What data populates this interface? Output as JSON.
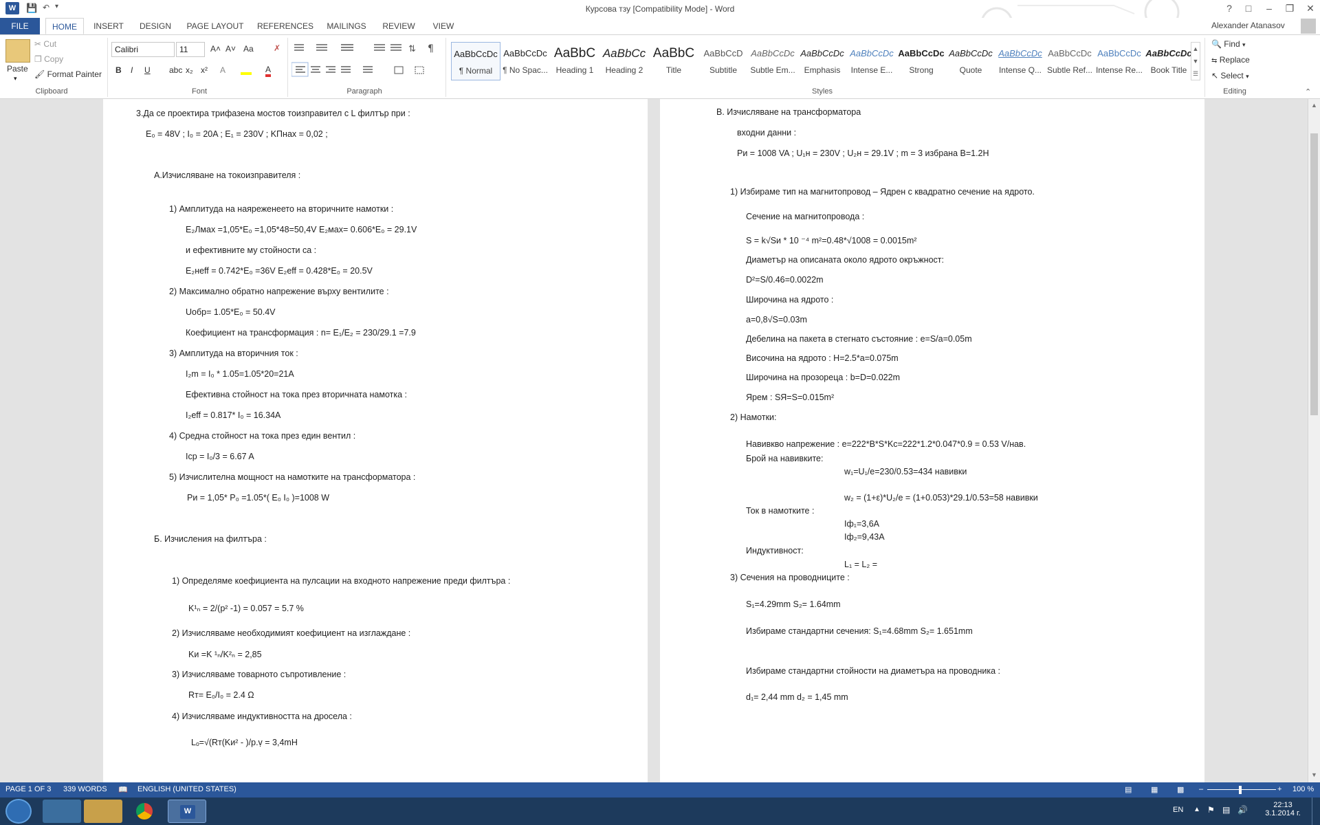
{
  "window": {
    "title": "Курсова тзу [Compatibility Mode] - Word",
    "user": "Alexander Atanasov",
    "app_icon": "W",
    "controls": [
      "?",
      "□",
      "–",
      "❐",
      "✕"
    ]
  },
  "ribbon_tabs": [
    "FILE",
    "HOME",
    "INSERT",
    "DESIGN",
    "PAGE LAYOUT",
    "REFERENCES",
    "MAILINGS",
    "REVIEW",
    "VIEW"
  ],
  "clipboard": {
    "paste": "Paste",
    "cut": "Cut",
    "copy": "Copy",
    "format_painter": "Format Painter",
    "label": "Clipboard"
  },
  "font": {
    "name": "Calibri",
    "size": "11",
    "label": "Font",
    "bold": "B",
    "italic": "I",
    "underline": "U",
    "sub": "x₂",
    "sup": "x²",
    "grow": "A˄",
    "shrink": "A˅",
    "case": "Aa"
  },
  "paragraph": {
    "label": "Paragraph"
  },
  "styles": {
    "label": "Styles",
    "items": [
      {
        "preview": "AaBbCcDc",
        "name": "¶ Normal"
      },
      {
        "preview": "AaBbCcDc",
        "name": "¶ No Spac..."
      },
      {
        "preview": "AaBbC",
        "name": "Heading 1"
      },
      {
        "preview": "AaBbCc",
        "name": "Heading 2"
      },
      {
        "preview": "AaBbC",
        "name": "Title"
      },
      {
        "preview": "AaBbCcD",
        "name": "Subtitle"
      },
      {
        "preview": "AaBbCcDc",
        "name": "Subtle Em..."
      },
      {
        "preview": "AaBbCcDc",
        "name": "Emphasis"
      },
      {
        "preview": "AaBbCcDc",
        "name": "Intense E..."
      },
      {
        "preview": "AaBbCcDc",
        "name": "Strong"
      },
      {
        "preview": "AaBbCcDc",
        "name": "Quote"
      },
      {
        "preview": "AaBbCcDc",
        "name": "Intense Q..."
      },
      {
        "preview": "AaBbCcDc",
        "name": "Subtle Ref..."
      },
      {
        "preview": "AaBbCcDc",
        "name": "Intense Re..."
      },
      {
        "preview": "AaBbCcDc",
        "name": "Book Title"
      }
    ]
  },
  "editing": {
    "label": "Editing",
    "find": "Find",
    "replace": "Replace",
    "select": "Select"
  },
  "page_left": {
    "lines": [
      "3.Да се проектира трифазена мостов тоизправител с L филтър при :",
      "E₀ = 48V ; I₀ = 20A ; E₁ = 230V ; KПнах = 0,02 ;",
      "А.Изчисляване на токоизправителя :",
      "1)    Амплитуда на наяреженеето на вторичните намотки :",
      "E₂Лмах =1,05*E₀ =1,05*48=50,4V   E₂мах= 0.606*E₀ = 29.1V",
      "и ефективните му стойности са :",
      "E₂неff = 0.742*E₀ =36V  E₂eff = 0.428*E₀ = 20.5V",
      "2)    Максимално обратно напрежение върху вентилите :",
      "Uобр= 1.05*E₀ = 50.4V",
      "Коефициент на трансформация :        n= E₁/E₂ = 230/29.1 =7.9",
      "3)     Амплитуда на вторичния ток  :",
      "I₂m = I₀ * 1.05=1.05*20=21A",
      "Ефективна стойност на тока през вторичната намотка :",
      "I₂eff = 0.817* I₀ = 16.34A",
      "4)     Средна стойност на тока през един вентил :",
      "Iср = I₀/3 = 6.67 A",
      "5)    Изчислителна мощност на намотките на трансформатора :",
      "Pи = 1,05* P₀ =1.05*( E₀ I₀ )=1008 W",
      "Б.   Изчисления на филтъра :",
      "1)    Определяме коефициента на пулсации на входното напрежение преди филтъра :",
      "K¹ₙ =  2/(p² -1) = 0.057 = 5.7 %",
      "2)     Изчисляваме необходимият коефициент на изглаждане :",
      "Kи =K ¹ₙ/K²ₙ = 2,85",
      "3)    Изчисляваме товарното съпротивление :",
      "Rт= E₀/I₀ = 2.4 Ω",
      "4)    Изчисляваме индуктивността на дросела :",
      "Lₒ=√(Rт(Kи² - )/p.ṿ = 3,4mH"
    ]
  },
  "page_right": {
    "lines": [
      "В.  Изчисляване на трансформатора",
      "входни данни :",
      "Pи = 1008 VA  ;  U₁н = 230V ; U₂н = 29.1V ; m = 3 избрана B=1.2H",
      "1)    Избираме тип на магнитопровод – Ядрен с квадратно сечение на ядрото.",
      "Сечение на магнитопровода :",
      "S = k√Sи * 10 ⁻⁴ m²=0.48*√1008 = 0.0015m²",
      "Диаметър на описаната около ядрото окръжност:",
      "D²=S/0.46=0.0022m",
      "Широчина на ядрото  :",
      "a=0,8√S=0.03m",
      "Дебелина на пакета в стегнато състояние :       e=S/a=0.05m",
      "Височина на ядрото :        H=2.5*a=0.075m",
      "Широчина на прозореца :    b=D=0.022m",
      "Ярем :       SЯ=S=0.015m²",
      "2)    Намотки:",
      "Навивкво напрежение :   e=222*B*S*Kс=222*1.2*0.047*0.9 = 0.53 V/нав.",
      "Брой на навивките:",
      "w₁=U₁/e=230/0.53=434 навивки",
      "w₂ = (1+ε)*U₂/e = (1+0.053)*29.1/0.53=58 навивки",
      "Ток в намотките :",
      "Iф₁=3,6A",
      "Iф₂=9,43A",
      "Индуктивност:",
      "L₁ =            L₂ =",
      "3)    Сечения на проводниците :",
      "S₁=4.29mm       S₂= 1.64mm",
      "Избираме стандартни сечения:      S₁=4.68mm       S₂= 1.651mm",
      "Избираме стандартни стойности на диаметъра на проводника :",
      "d₁= 2,44 mm                       d₂ = 1,45 mm"
    ]
  },
  "status": {
    "page": "PAGE 1 OF 3",
    "words": "339 WORDS",
    "language": "ENGLISH (UNITED STATES)",
    "zoom": "100 %"
  },
  "taskbar": {
    "lang": "EN",
    "time": "22:13",
    "date": "3.1.2014 г."
  },
  "colors": {
    "accent": "#2b579a",
    "taskbar": "#1d3a5c"
  }
}
